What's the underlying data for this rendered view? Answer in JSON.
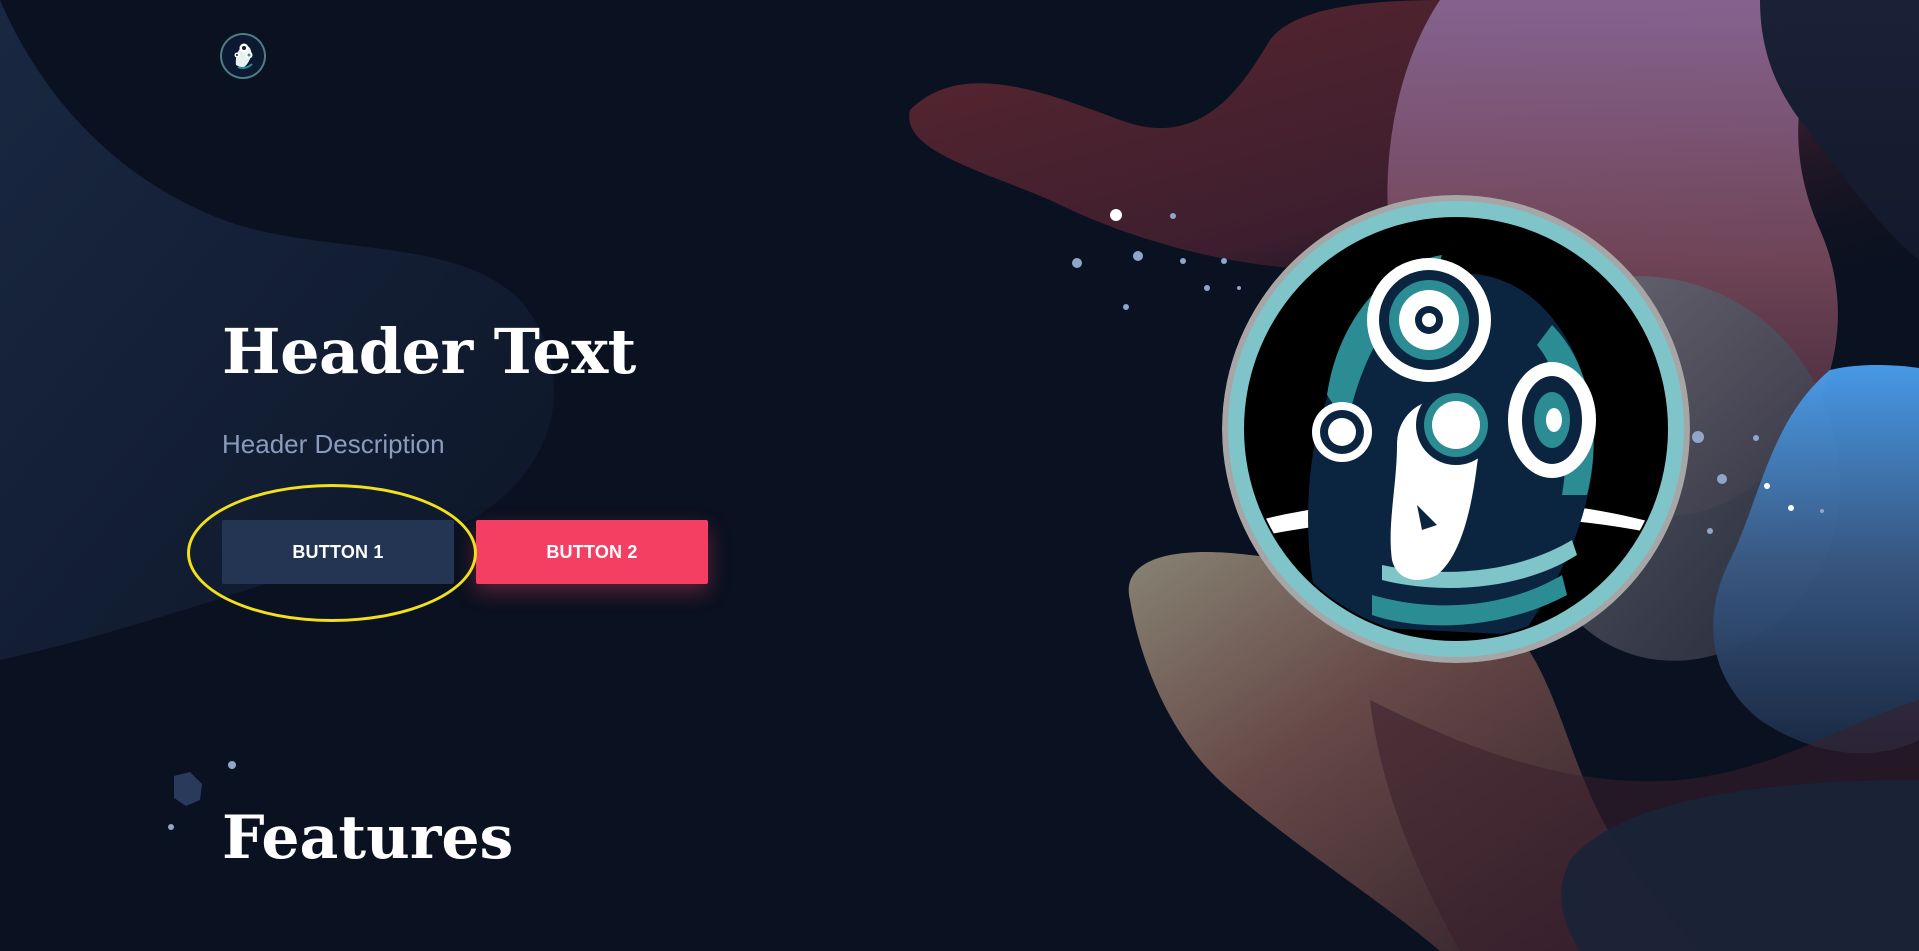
{
  "header": {
    "logo_icon": "robot-head-logo-icon",
    "title": "Header Text",
    "description": "Header Description"
  },
  "hero": {
    "button_1_label": "BUTTON 1",
    "button_2_label": "BUTTON 2",
    "image_icon": "robot-head-gears-illustration"
  },
  "features": {
    "title": "Features"
  },
  "colors": {
    "background": "#0a1120",
    "button_1": "#243453",
    "button_2": "#f43f62",
    "annotation_ring": "#f1e01a",
    "description": "#8a9bbd",
    "teal_accent": "#7fc4c8"
  }
}
